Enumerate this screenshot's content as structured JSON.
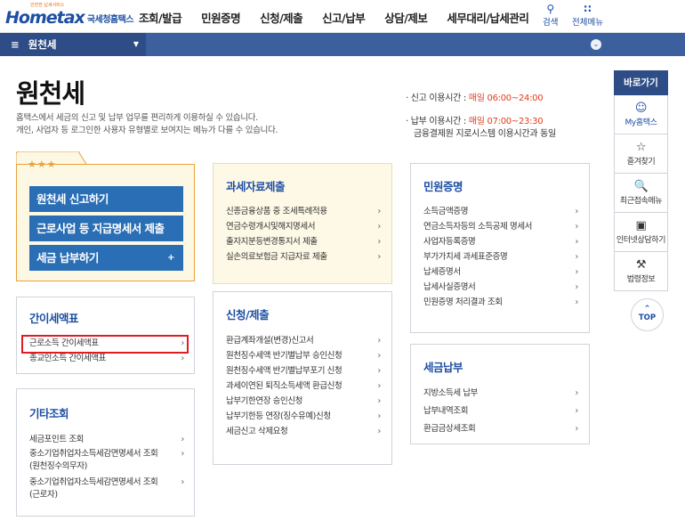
{
  "header": {
    "logo_small": "안전한 납세서비스",
    "logo_mark": "Hometax",
    "logo_sub": "국세청홈택스",
    "menu": [
      "조회/발급",
      "민원증명",
      "신청/제출",
      "신고/납부",
      "상담/제보",
      "세무대리/납세관리"
    ],
    "search_label": "검색",
    "allmenu_label": "전체메뉴"
  },
  "bar": {
    "section": "원천세"
  },
  "page": {
    "title": "원천세",
    "desc1": "홈택스에서 세금의 신고 및 납부 업무를 편리하게 이용하실 수 있습니다.",
    "desc2": "개인, 사업자 등 로그인한 사용자 유형별로 보여지는 메뉴가 다를 수 있습니다."
  },
  "hours": {
    "report_label": "· 신고 이용시간 : ",
    "report_time": "매일 06:00~24:00",
    "pay_label": "· 납부 이용시간 : ",
    "pay_time": "매일 07:00~23:30",
    "pay_note": "금융결제원 지로시스템 이용시간과 동일"
  },
  "main_card": {
    "stars": "★★★",
    "buttons": [
      "원천세 신고하기",
      "근로사업 등 지급명세서 제출",
      "세금 납부하기"
    ],
    "plus": "+"
  },
  "simple_table": {
    "title": "간이세액표",
    "items": [
      "근로소득 간이세액표",
      "종교인소득 간이세액표"
    ]
  },
  "other": {
    "title": "기타조회",
    "items": [
      "세금포인트 조회",
      "중소기업취업자소득세감면명세서 조회",
      "(원천징수의무자)",
      "중소기업취업자소득세감면명세서 조회",
      "(근로자)"
    ]
  },
  "tax_submit": {
    "title": "과세자료제출",
    "items": [
      "신종금융상품 중 조세특례적용",
      "연금수령개시및해지명세서",
      "출자지분등변경통지서 제출",
      "실손의료보험금 지급자료 제출"
    ]
  },
  "apply": {
    "title": "신청/제출",
    "items": [
      "환급계좌개설(변경)신고서",
      "원천징수세액 반기별납부 승인신청",
      "원천징수세액 반기별납부포기 신청",
      "과세이연된 퇴직소득세액 환급신청",
      "납부기한연장 승인신청",
      "납부기한등 연장(징수유예)신청",
      "세금신고 삭제요청"
    ]
  },
  "civil": {
    "title": "민원증명",
    "items": [
      "소득금액증명",
      "연금소득자등의 소득공제 명세서",
      "사업자등록증명",
      "부가가치세 과세표준증명",
      "납세증명서",
      "납세사실증명서",
      "민원증명 처리결과 조회"
    ]
  },
  "tax_pay": {
    "title": "세금납부",
    "items": [
      "지방소득세 납부",
      "납부내역조회",
      "환급금상세조회"
    ]
  },
  "quick": {
    "title": "바로가기",
    "items": [
      "My홈택스",
      "즐겨찾기",
      "최근접속메뉴",
      "인터넷상담하기",
      "법령정보"
    ],
    "top": "TOP"
  },
  "chevron": "›"
}
